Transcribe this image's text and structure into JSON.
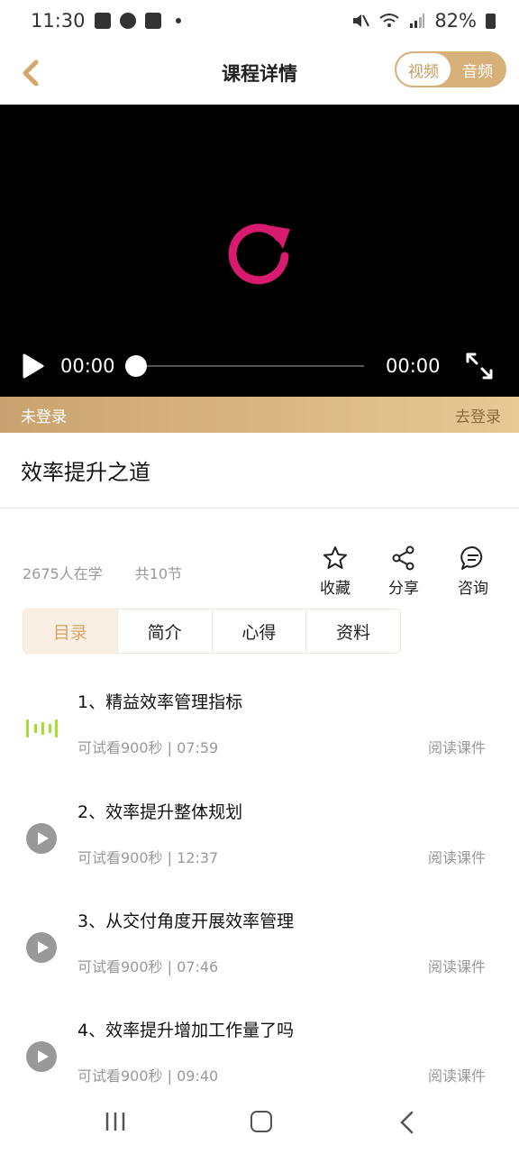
{
  "status_bar": {
    "time": "11:30",
    "battery": "82%"
  },
  "header": {
    "title": "课程详情",
    "toggle_video": "视频",
    "toggle_audio": "音频"
  },
  "player": {
    "current_time": "00:00",
    "total_time": "00:00",
    "progress": 0
  },
  "login_bar": {
    "status": "未登录",
    "action": "去登录"
  },
  "course": {
    "title": "效率提升之道",
    "learners": "2675人在学",
    "sections": "共10节"
  },
  "actions": {
    "favorite": "收藏",
    "share": "分享",
    "consult": "咨询"
  },
  "tabs": [
    "目录",
    "简介",
    "心得",
    "资料"
  ],
  "lessons": [
    {
      "title": "1、精益效率管理指标",
      "meta": "可试看900秒 | 07:59",
      "action": "阅读课件"
    },
    {
      "title": "2、效率提升整体规划",
      "meta": "可试看900秒 | 12:37",
      "action": "阅读课件"
    },
    {
      "title": "3、从交付角度开展效率管理",
      "meta": "可试看900秒 | 07:46",
      "action": "阅读课件"
    },
    {
      "title": "4、效率提升增加工作量了吗",
      "meta": "可试看900秒 | 09:40",
      "action": "阅读课件"
    }
  ],
  "colors": {
    "accent": "#d6a76a",
    "replay": "#d81b6e",
    "playing": "#a4e02f"
  }
}
